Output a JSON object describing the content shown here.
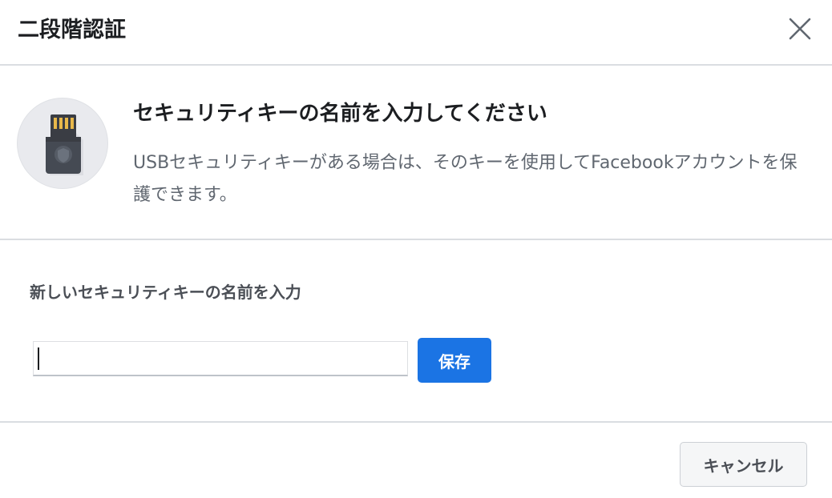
{
  "dialog": {
    "title": "二段階認証",
    "close_icon": "close-icon"
  },
  "intro": {
    "icon": "usb-security-key-icon",
    "heading": "セキュリティキーの名前を入力してください",
    "description": "USBセキュリティキーがある場合は、そのキーを使用してFacebookアカウントを保護できます。"
  },
  "form": {
    "label": "新しいセキュリティキーの名前を入力",
    "input_value": "",
    "save_label": "保存"
  },
  "footer": {
    "cancel_label": "キャンセル"
  },
  "colors": {
    "accent": "#1b74e4",
    "divider": "#dadde1",
    "secondary_text": "#606770"
  }
}
